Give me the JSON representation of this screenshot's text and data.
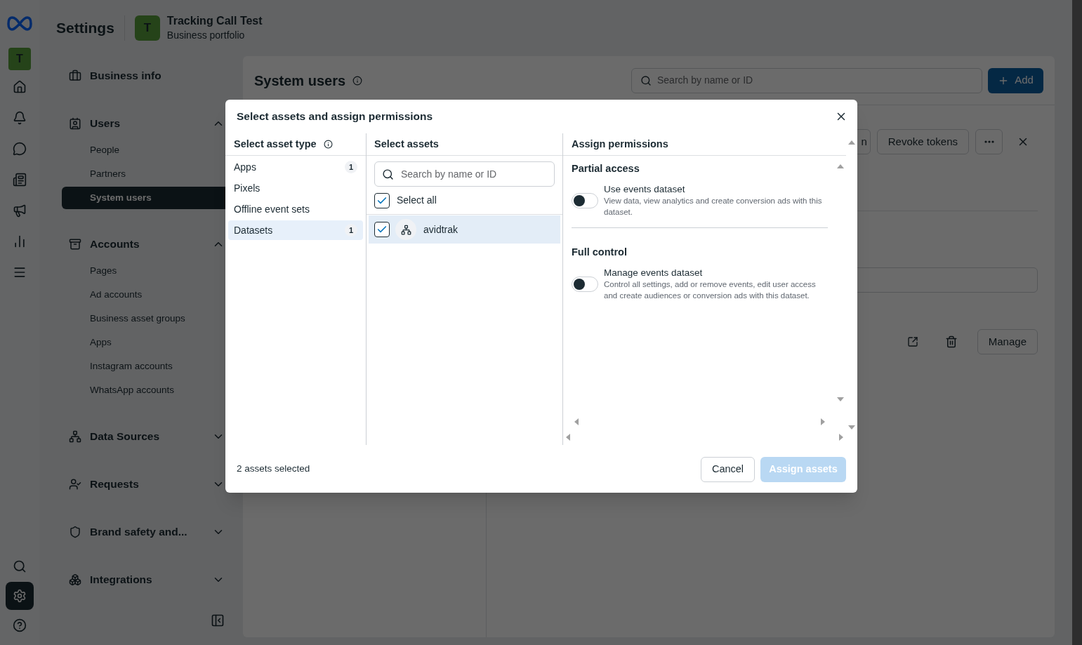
{
  "header": {
    "title": "Settings",
    "portfolio": {
      "initial": "T",
      "name": "Tracking Call Test",
      "subtitle": "Business portfolio"
    }
  },
  "rail": {
    "initial": "T",
    "items": [
      {
        "kind": "home",
        "selected": false
      },
      {
        "kind": "notifications",
        "selected": false
      },
      {
        "kind": "messages",
        "selected": false
      },
      {
        "kind": "content",
        "selected": false
      },
      {
        "kind": "ads",
        "selected": false
      },
      {
        "kind": "insights",
        "selected": false
      },
      {
        "kind": "menu",
        "selected": false
      }
    ],
    "bottom_items": [
      {
        "kind": "search",
        "selected": false
      },
      {
        "kind": "settings",
        "selected": true
      },
      {
        "kind": "help",
        "selected": false
      }
    ]
  },
  "sidebar": {
    "sections": [
      {
        "kind": "link",
        "label": "Business info"
      },
      {
        "kind": "group",
        "label": "Users",
        "expanded": true,
        "children": [
          {
            "label": "People",
            "selected": false
          },
          {
            "label": "Partners",
            "selected": false
          },
          {
            "label": "System users",
            "selected": true
          }
        ]
      },
      {
        "kind": "group",
        "label": "Accounts",
        "expanded": true,
        "children": [
          {
            "label": "Pages",
            "selected": false
          },
          {
            "label": "Ad accounts",
            "selected": false
          },
          {
            "label": "Business asset groups",
            "selected": false
          },
          {
            "label": "Apps",
            "selected": false
          },
          {
            "label": "Instagram accounts",
            "selected": false
          },
          {
            "label": "WhatsApp accounts",
            "selected": false
          }
        ]
      },
      {
        "kind": "group",
        "label": "Data Sources",
        "expanded": false
      },
      {
        "kind": "group",
        "label": "Requests",
        "expanded": false
      },
      {
        "kind": "group",
        "label": "Brand safety and...",
        "expanded": false
      },
      {
        "kind": "group",
        "label": "Integrations",
        "expanded": false
      }
    ]
  },
  "main": {
    "title": "System users",
    "search": {
      "placeholder": "Search by name or ID"
    },
    "add_button": "Add",
    "toolbar": {
      "partial_button": "n",
      "revoke_button": "Revoke tokens"
    },
    "manage_button": "Manage"
  },
  "modal": {
    "title": "Select assets and assign permissions",
    "asset_types": {
      "heading": "Select asset type",
      "items": [
        {
          "label": "Apps",
          "count": "1",
          "selected": false
        },
        {
          "label": "Pixels",
          "selected": false
        },
        {
          "label": "Offline event sets",
          "selected": false
        },
        {
          "label": "Datasets",
          "count": "1",
          "selected": true
        }
      ]
    },
    "assets": {
      "heading": "Select assets",
      "search": {
        "placeholder": "Search by name or ID"
      },
      "select_all": {
        "label": "Select all",
        "checked": true
      },
      "items": [
        {
          "name": "avidtrak",
          "checked": true,
          "selected": true
        }
      ]
    },
    "permissions": {
      "heading": "Assign permissions",
      "groups": [
        {
          "title": "Partial access",
          "options": [
            {
              "label": "Use events dataset",
              "description": "View data, view analytics and create conversion ads with this dataset.",
              "on": false
            }
          ]
        },
        {
          "title": "Full control",
          "options": [
            {
              "label": "Manage events dataset",
              "description": "Control all settings, add or remove events, edit user access and create audiences or conversion ads with this dataset.",
              "on": false
            }
          ]
        }
      ]
    },
    "footer": {
      "summary": "2 assets selected",
      "cancel": "Cancel",
      "confirm": {
        "label": "Assign assets",
        "disabled": true
      }
    }
  }
}
